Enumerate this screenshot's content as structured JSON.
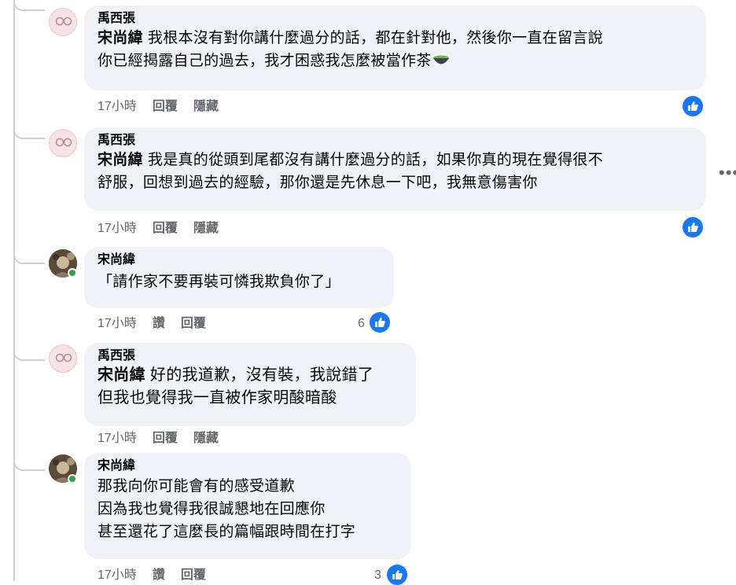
{
  "comments": [
    {
      "author": "禹西張",
      "mention": "宋尚緯",
      "text": "我根本沒有對你講什麼過分的話，都在針對他，然後你一直在留言說\n你已經揭露自己的過去，我才困惑我怎麼被當作茶",
      "emoji": "tea-bowl-icon",
      "time": "17小時",
      "actions": [
        "回覆",
        "隱藏"
      ],
      "likes": ""
    },
    {
      "author": "禹西張",
      "mention": "宋尚緯",
      "text": "我是真的從頭到尾都沒有講什麼過分的話，如果你真的現在覺得很不\n舒服，回想到過去的經驗，那你還是先休息一下吧，我無意傷害你",
      "time": "17小時",
      "actions": [
        "回覆",
        "隱藏"
      ],
      "likes": ""
    },
    {
      "author": "宋尚緯",
      "mention": "",
      "text": "「請作家不要再裝可憐我欺負你了」",
      "time": "17小時",
      "actions": [
        "讚",
        "回覆"
      ],
      "likes": "6"
    },
    {
      "author": "禹西張",
      "mention": "宋尚緯",
      "text": "好的我道歉，沒有裝，我說錯了\n但我也覺得我一直被作家明酸暗酸",
      "time": "17小時",
      "actions": [
        "回覆",
        "隱藏"
      ],
      "likes": ""
    },
    {
      "author": "宋尚緯",
      "mention": "",
      "text": "那我向你可能會有的感受道歉\n因為我也覺得我很誠懇地在回應你\n甚至還花了這麼長的篇幅跟時間在打字",
      "time": "17小時",
      "actions": [
        "讚",
        "回覆"
      ],
      "likes": "3"
    }
  ],
  "colors": {
    "bubble": "#f0f2f5",
    "like_blue": "#1877f2",
    "meta_gray": "#65676b",
    "online": "#31a24c"
  },
  "icons": {
    "like": "thumbs-up-icon",
    "more": "more-horizontal-icon"
  }
}
